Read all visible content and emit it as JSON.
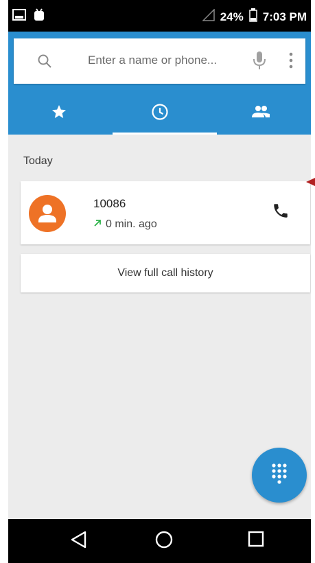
{
  "status_bar": {
    "battery": "24%",
    "time": "7:03 PM",
    "icons": [
      "screenshot-icon",
      "android-icon",
      "signal-icon",
      "battery-icon"
    ]
  },
  "search": {
    "placeholder": "Enter a name or phone..."
  },
  "tabs": [
    {
      "name": "speed-dial",
      "icon": "star-icon"
    },
    {
      "name": "recents",
      "icon": "clock-icon",
      "selected": true
    },
    {
      "name": "contacts",
      "icon": "people-icon"
    }
  ],
  "section": {
    "label": "Today"
  },
  "call_log": [
    {
      "number": "10086",
      "time": "0 min. ago",
      "type": "outgoing-call-icon"
    }
  ],
  "history": {
    "label": "View full call history"
  },
  "colors": {
    "primary": "#2a8ecf",
    "avatar": "#ee7226",
    "outgoing": "#2db34a",
    "background": "#ececec"
  }
}
